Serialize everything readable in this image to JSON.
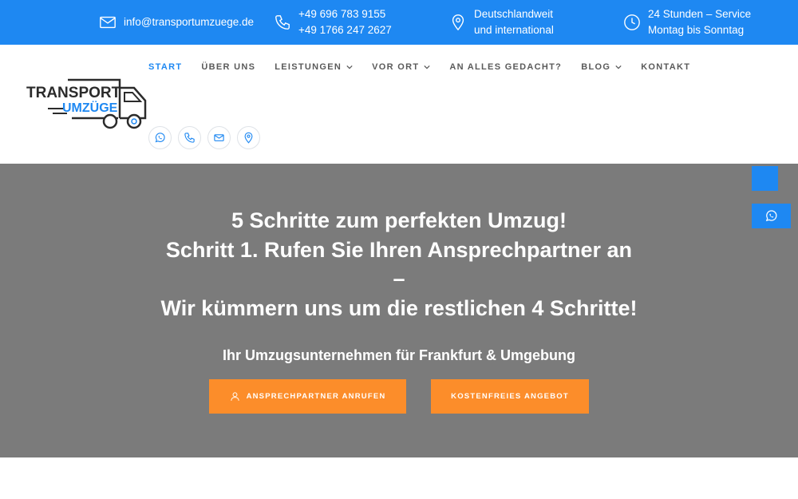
{
  "topbar": {
    "email": {
      "icon": "mail-icon",
      "text": "info@transportumzuege.de"
    },
    "phone": {
      "icon": "phone-icon",
      "line1": "+49 696 783 9155",
      "line2": "+49 1766 247 2627"
    },
    "location": {
      "icon": "location-pin-icon",
      "line1": "Deutschlandweit",
      "line2": "und international"
    },
    "hours": {
      "icon": "clock-icon",
      "line1": "24 Stunden – Service",
      "line2": "Montag bis Sonntag"
    }
  },
  "logo": {
    "line1": "TRANSPORT",
    "line2": "UMZÜGE"
  },
  "nav": {
    "items": [
      {
        "label": "START",
        "active": true,
        "dropdown": false
      },
      {
        "label": "ÜBER UNS",
        "active": false,
        "dropdown": false
      },
      {
        "label": "LEISTUNGEN",
        "active": false,
        "dropdown": true
      },
      {
        "label": "VOR ORT",
        "active": false,
        "dropdown": true
      },
      {
        "label": "AN ALLES GEDACHT?",
        "active": false,
        "dropdown": false
      },
      {
        "label": "BLOG",
        "active": false,
        "dropdown": true
      },
      {
        "label": "KONTAKT",
        "active": false,
        "dropdown": false
      }
    ]
  },
  "social": [
    "whatsapp-icon",
    "phone-icon",
    "mail-icon",
    "location-pin-icon"
  ],
  "hero": {
    "title_lines": [
      "5 Schritte zum perfekten Umzug!",
      "Schritt 1. Rufen Sie Ihren Ansprechpartner an",
      "–",
      "Wir kümmern uns um die restlichen 4 Schritte!"
    ],
    "subtitle": "Ihr Umzugsunternehmen für Frankfurt & Umgebung",
    "button_call": "ANSPRECHPARTNER ANRUFEN",
    "button_offer": "KOSTENFREIES ANGEBOT"
  },
  "colors": {
    "primary": "#1e88f2",
    "accent": "#fc8d2a",
    "hero_bg": "#7b7b7b",
    "nav_text": "#5a5a5a"
  }
}
